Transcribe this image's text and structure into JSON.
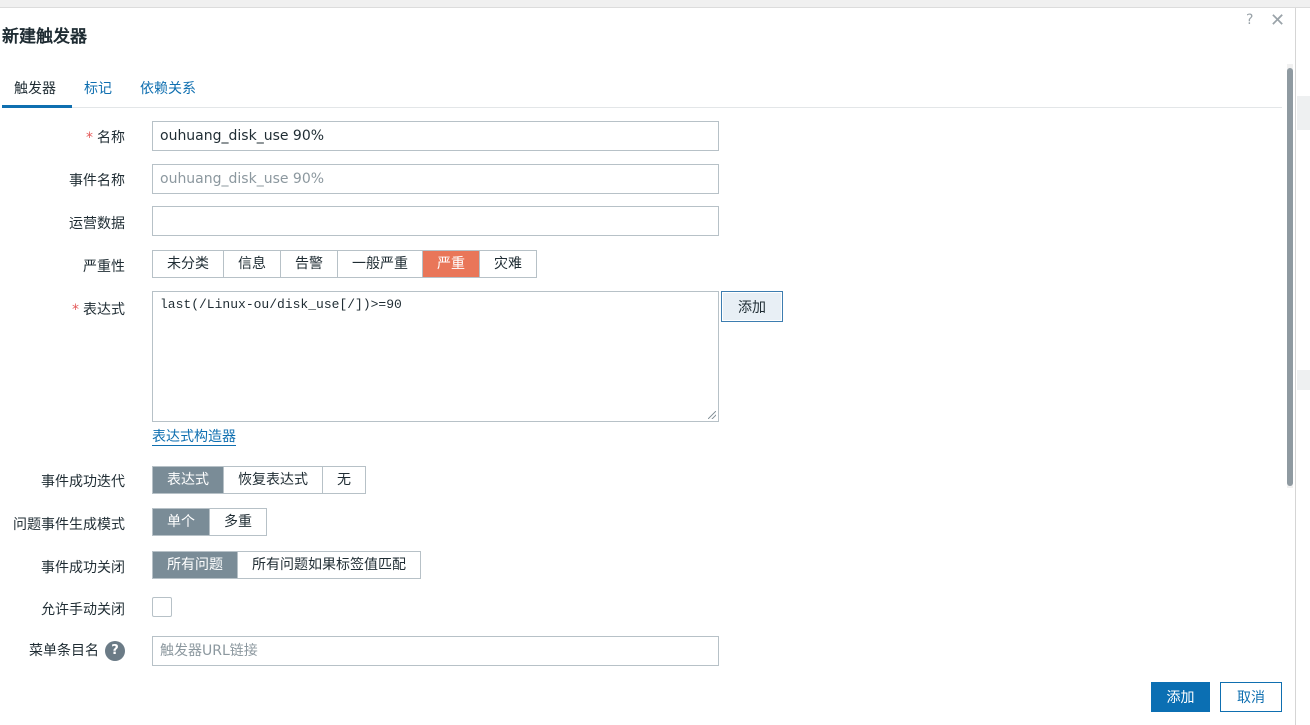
{
  "dialog": {
    "title": "新建触发器",
    "help_glyph": "?",
    "close_glyph": "✕"
  },
  "tabs": [
    {
      "label": "触发器",
      "active": true
    },
    {
      "label": "标记",
      "active": false
    },
    {
      "label": "依赖关系",
      "active": false
    }
  ],
  "form": {
    "required_mark": "*",
    "name": {
      "label": "名称",
      "value": "ouhuang_disk_use 90%"
    },
    "event_name": {
      "label": "事件名称",
      "placeholder": "ouhuang_disk_use 90%"
    },
    "opdata": {
      "label": "运营数据",
      "value": ""
    },
    "severity": {
      "label": "严重性",
      "options": [
        "未分类",
        "信息",
        "告警",
        "一般严重",
        "严重",
        "灾难"
      ],
      "selected": "严重",
      "selected_color": "#e97659"
    },
    "expression": {
      "label": "表达式",
      "value": "last(/Linux-ou/disk_use[/])>=90",
      "add_label": "添加",
      "constructor_link": "表达式构造器"
    },
    "ok_event_generation": {
      "label": "事件成功迭代",
      "options": [
        "表达式",
        "恢复表达式",
        "无"
      ],
      "selected": "表达式"
    },
    "problem_event_mode": {
      "label": "问题事件生成模式",
      "options": [
        "单个",
        "多重"
      ],
      "selected": "单个"
    },
    "ok_event_closes": {
      "label": "事件成功关闭",
      "options": [
        "所有问题",
        "所有问题如果标签值匹配"
      ],
      "selected": "所有问题"
    },
    "manual_close": {
      "label": "允许手动关闭",
      "checked": false
    },
    "url_name": {
      "label": "菜单条目名",
      "help_glyph": "?",
      "placeholder": "触发器URL链接"
    }
  },
  "footer": {
    "add_label": "添加",
    "cancel_label": "取消"
  },
  "colors": {
    "primary": "#0b6fb3",
    "link": "#0f6fb0",
    "selected_segment": "#7a8c97"
  }
}
